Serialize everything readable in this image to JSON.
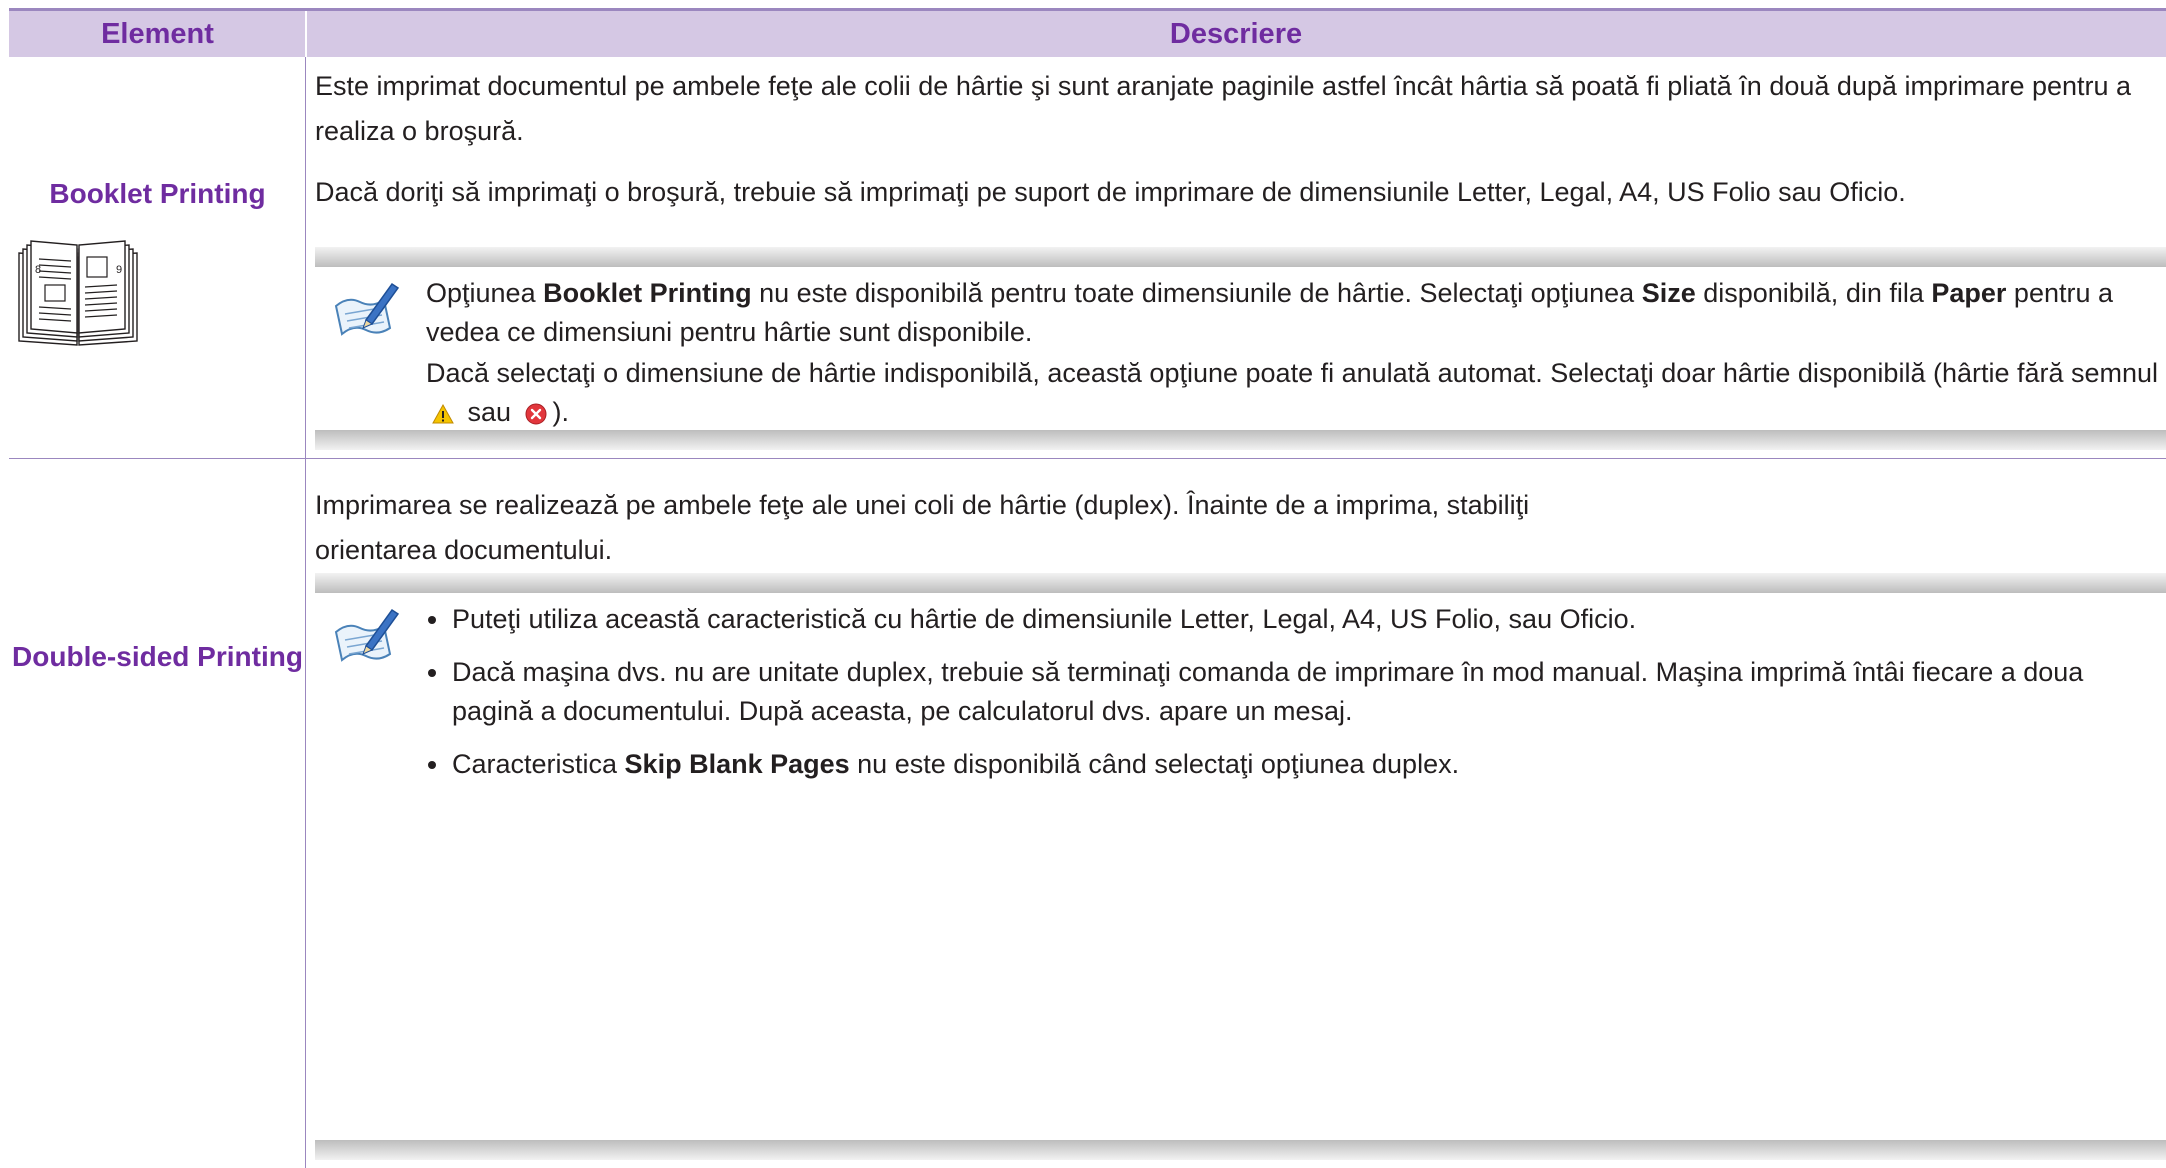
{
  "table": {
    "header": {
      "element": "Element",
      "description": "Descriere"
    },
    "rows": [
      {
        "element": "Booklet Printing",
        "description": [
          "Este imprimat documentul pe ambele feţe ale colii de hârtie şi sunt aranjate paginile astfel încât hârtia să poată fi pliată în două după imprimare pentru a realiza o broşură.",
          "Dacă doriţi să imprimaţi o broşură, trebuie să imprimaţi pe suport de imprimare de dimensiunile Letter, Legal, A4, US Folio sau Oficio."
        ],
        "illustration_pages": [
          "8",
          "9"
        ],
        "note": {
          "p1_a": "Opţiunea ",
          "p1_b": "Booklet Printing",
          "p1_c": " nu este disponibilă pentru toate dimensiunile de hârtie. Selectaţi opţiunea ",
          "p1_d": "Size",
          "p1_e": " disponibilă, din fila ",
          "p1_f": "Paper",
          "p1_g": " pentru a vedea ce dimensiuni pentru hârtie sunt disponibile.",
          "p2_a": "Dacă selectaţi o dimensiune de hârtie indisponibilă, această opţiune poate fi anulată automat. Selectaţi doar hârtie disponibilă (hârtie fără semnul ",
          "p2_b": " sau ",
          "p2_c": ")."
        }
      },
      {
        "element": "Double-sided Printing",
        "description": [
          "Imprimarea se realizează pe ambele feţe ale unei coli de hârtie (duplex). Înainte de a imprima, stabiliţi orientarea documentului."
        ],
        "note_bullets": {
          "b1": "Puteţi utiliza această caracteristică cu hârtie de dimensiunile Letter, Legal, A4, US Folio, sau Oficio.",
          "b2": "Dacă maşina dvs. nu are unitate duplex, trebuie să terminaţi comanda de imprimare în mod manual. Maşina imprimă întâi fiecare a doua pagină a documentului. După aceasta, pe calculatorul dvs. apare un mesaj.",
          "b3_a": "Caracteristica ",
          "b3_b": "Skip Blank Pages",
          "b3_c": " nu este disponibilă când selectaţi opţiunea duplex."
        }
      }
    ]
  },
  "icons": {
    "note": "note-pencil-icon",
    "warning": "warning-triangle-icon",
    "error": "error-x-icon"
  },
  "colors": {
    "header_bg": "#d5c8e4",
    "accent_text": "#6f2ca0",
    "rule": "#9b87bf"
  }
}
